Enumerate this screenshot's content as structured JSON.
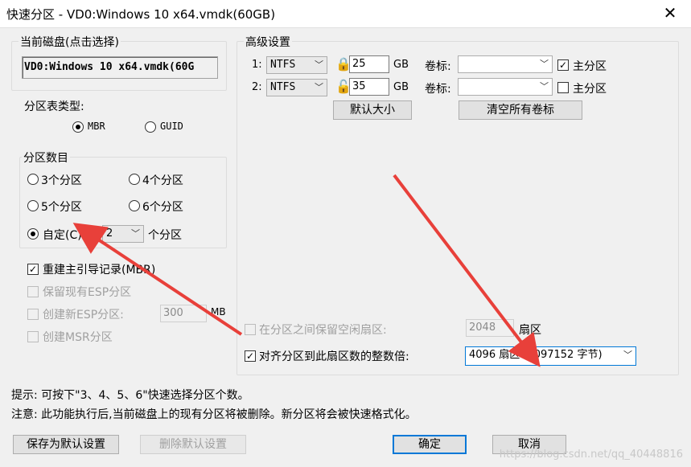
{
  "window": {
    "title": "快速分区 - VD0:Windows 10 x64.vmdk(60GB)",
    "close_icon": "close-icon"
  },
  "current_disk": {
    "group_title": "当前磁盘(点击选择)",
    "value": "VD0:Windows 10 x64.vmdk(60G"
  },
  "partition_table": {
    "label": "分区表类型:",
    "options": [
      "MBR",
      "GUID"
    ],
    "selected": "MBR"
  },
  "partition_count": {
    "group_title": "分区数目",
    "options": [
      "3个分区",
      "4个分区",
      "5个分区",
      "6个分区"
    ],
    "custom_label": "自定(C):",
    "custom_value": "2",
    "custom_suffix": "个分区",
    "selected": "custom"
  },
  "options": {
    "rebuild_mbr": "重建主引导记录(MBR)",
    "keep_esp": "保留现有ESP分区",
    "create_esp": "创建新ESP分区:",
    "esp_size": "300",
    "esp_unit": "MB",
    "create_msr": "创建MSR分区"
  },
  "advanced": {
    "group_title": "高级设置",
    "rows": [
      {
        "index": "1:",
        "fs": "NTFS",
        "size": "25",
        "unit": "GB",
        "volume_label": "卷标:",
        "volume_value": "",
        "primary_label": "主分区",
        "primary_checked": true,
        "lock": "locked"
      },
      {
        "index": "2:",
        "fs": "NTFS",
        "size": "35",
        "unit": "GB",
        "volume_label": "卷标:",
        "volume_value": "",
        "primary_label": "主分区",
        "primary_checked": false,
        "lock": "unlocked"
      }
    ],
    "default_size_button": "默认大小",
    "clear_labels_button": "清空所有卷标",
    "reserve_label": "在分区之间保留空闲扇区:",
    "reserve_value": "2048",
    "reserve_unit": "扇区",
    "align_label": "对齐分区到此扇区数的整数倍:",
    "align_value": "4096 扇区 (2097152 字节)"
  },
  "hints": {
    "tip": "提示: 可按下\"3、4、5、6\"快速选择分区个数。",
    "note": "注意: 此功能执行后,当前磁盘上的现有分区将被删除。新分区将会被快速格式化。"
  },
  "buttons": {
    "save_default": "保存为默认设置",
    "delete_default": "删除默认设置",
    "ok": "确定",
    "cancel": "取消"
  },
  "watermark": "https://blog.csdn.net/qq_40448816",
  "colors": {
    "arrow": "#e8403a",
    "focus_border": "#0078d7"
  }
}
